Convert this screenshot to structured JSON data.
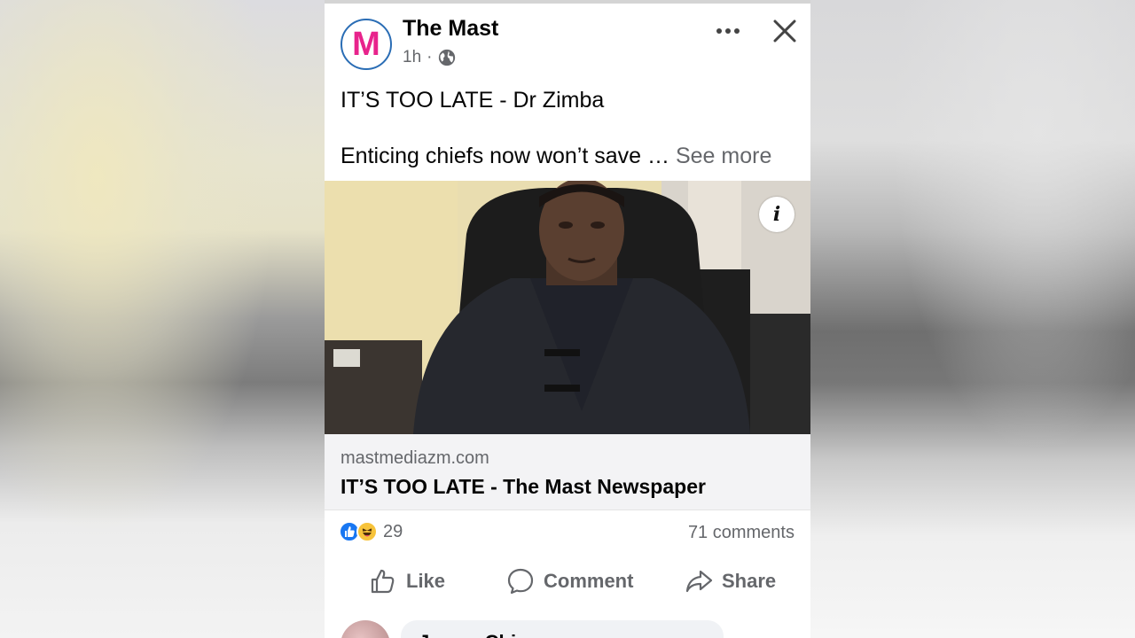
{
  "post": {
    "page_name": "The Mast",
    "avatar_letter": "M",
    "time": "1h",
    "separator": "·",
    "headline": "IT’S TOO LATE - Dr Zimba",
    "body_preview": "Enticing chiefs now won’t save …",
    "see_more": "See more",
    "icons": {
      "more": "more-options-icon",
      "close": "close-icon",
      "privacy": "globe-icon",
      "info": "info-icon"
    }
  },
  "link": {
    "domain": "mastmediazm.com",
    "title": "IT’S TOO LATE - The Mast Newspaper"
  },
  "stats": {
    "reaction_count": "29",
    "comments": "71 comments",
    "reactions": [
      "like",
      "haha"
    ]
  },
  "actions": {
    "like": "Like",
    "comment": "Comment",
    "share": "Share"
  },
  "comment_preview": {
    "name": "James Chipupe"
  },
  "colors": {
    "accent": "#1877f2",
    "avatar_ring": "#2a6db5",
    "avatar_letter": "#e8238c",
    "text_primary": "#050505",
    "text_secondary": "#65676b"
  }
}
